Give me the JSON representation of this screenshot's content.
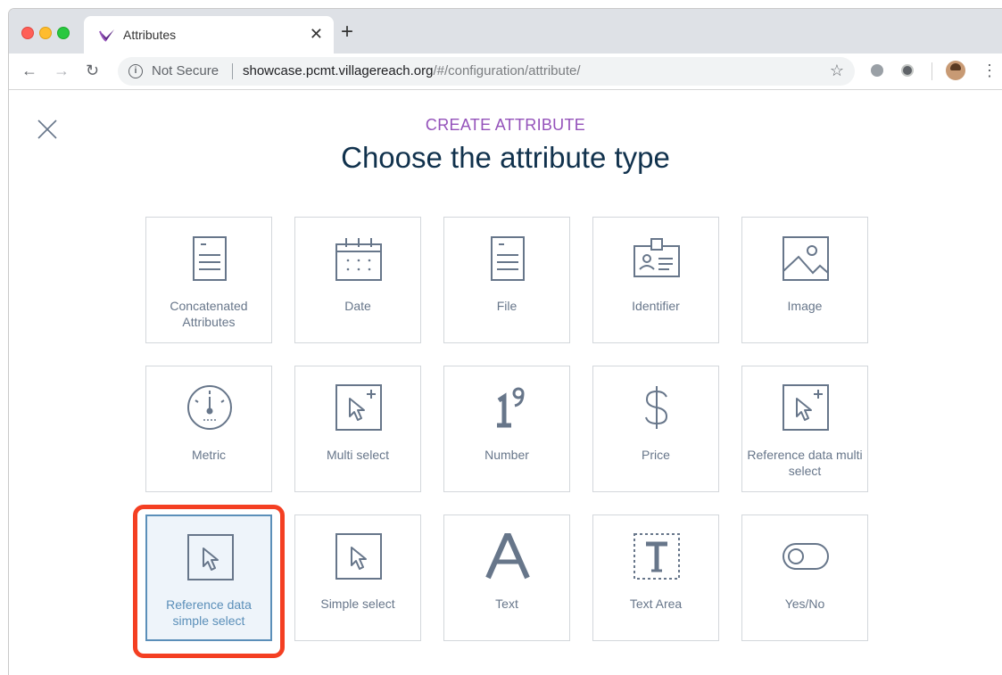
{
  "browser": {
    "tab_title": "Attributes",
    "security_label": "Not Secure",
    "url_host": "showcase.pcmt.villagereach.org",
    "url_path": "/#/configuration/attribute/"
  },
  "page": {
    "eyebrow": "CREATE ATTRIBUTE",
    "title": "Choose the attribute type"
  },
  "tiles": [
    {
      "label": "Concatenated Attributes",
      "icon": "concatenated-icon",
      "selected": false
    },
    {
      "label": "Date",
      "icon": "calendar-icon",
      "selected": false
    },
    {
      "label": "File",
      "icon": "file-icon",
      "selected": false
    },
    {
      "label": "Identifier",
      "icon": "id-card-icon",
      "selected": false
    },
    {
      "label": "Image",
      "icon": "image-icon",
      "selected": false
    },
    {
      "label": "Metric",
      "icon": "gauge-icon",
      "selected": false
    },
    {
      "label": "Multi select",
      "icon": "cursor-plus-icon",
      "selected": false
    },
    {
      "label": "Number",
      "icon": "number-icon",
      "selected": false
    },
    {
      "label": "Price",
      "icon": "dollar-icon",
      "selected": false
    },
    {
      "label": "Reference data multi select",
      "icon": "cursor-plus-icon",
      "selected": false
    },
    {
      "label": "Reference data simple select",
      "icon": "cursor-icon",
      "selected": true
    },
    {
      "label": "Simple select",
      "icon": "cursor-icon",
      "selected": false
    },
    {
      "label": "Text",
      "icon": "text-icon",
      "selected": false
    },
    {
      "label": "Text Area",
      "icon": "text-area-icon",
      "selected": false
    },
    {
      "label": "Yes/No",
      "icon": "toggle-icon",
      "selected": false
    }
  ],
  "colors": {
    "accent_purple": "#9452ba",
    "headline": "#11324d",
    "icon_gray": "#67768a",
    "selected_blue": "#5b8fb9",
    "highlight_red": "#f43f22"
  }
}
